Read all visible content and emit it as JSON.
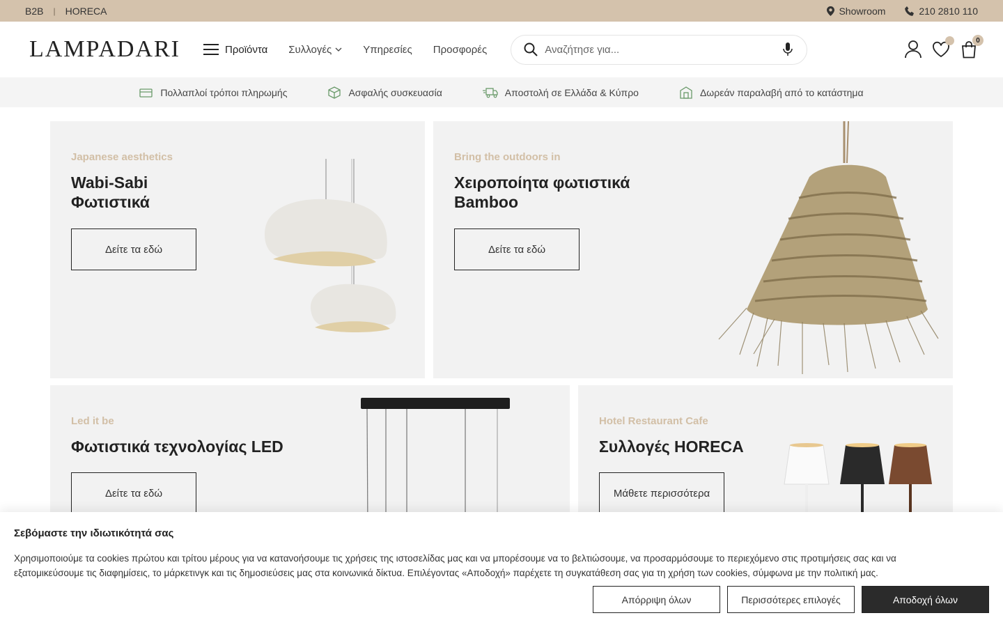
{
  "topbar": {
    "links": [
      "B2B",
      "HORECA"
    ],
    "separator": "|",
    "showroom": "Showroom",
    "phone": "210 2810 110"
  },
  "header": {
    "logo": "LAMPADARI",
    "menu_label": "Προϊόντα",
    "nav": [
      "Συλλογές",
      "Υπηρεσίες",
      "Προσφορές"
    ],
    "search_placeholder": "Αναζήτησε για...",
    "cart_count": "0"
  },
  "features": [
    "Πολλαπλοί τρόποι πληρωμής",
    "Ασφαλής συσκευασία",
    "Αποστολή σε Ελλάδα & Κύπρο",
    "Δωρεάν παραλαβή από το κατάστημα"
  ],
  "banners": [
    {
      "subtitle": "Japanese aesthetics",
      "title_line1": "Wabi-Sabi",
      "title_line2": "Φωτιστικά",
      "button": "Δείτε τα εδώ"
    },
    {
      "subtitle": "Bring the outdoors in",
      "title_line1": "Χειροποίητα φωτιστικά",
      "title_line2": "Bamboo",
      "button": "Δείτε τα εδώ"
    },
    {
      "subtitle": "Led it be",
      "title_line1": "Φωτιστικά τεχνολογίας LED",
      "button": "Δείτε τα εδώ"
    },
    {
      "subtitle": "Hotel Restaurant Cafe",
      "title_line1": "Συλλογές HORECA",
      "button": "Μάθετε περισσότερα"
    }
  ],
  "cookie": {
    "title": "Σεβόμαστε την ιδιωτικότητά σας",
    "text": "Χρησιμοποιούμε τα cookies πρώτου και τρίτου μέρους για να κατανοήσουμε τις χρήσεις της ιστοσελίδας μας και να μπορέσουμε να το βελτιώσουμε, να προσαρμόσουμε το περιεχόμενο στις προτιμήσεις σας και να εξατομικεύσουμε τις διαφημίσεις, το μάρκετινγκ και τις δημοσιεύσεις μας στα κοινωνικά δίκτυα. Επιλέγοντας «Αποδοχή» παρέχετε τη συγκατάθεση σας για τη χρήση των cookies, σύμφωνα με την πολιτική μας.",
    "reject": "Απόρριψη όλων",
    "more": "Περισσότερες επιλογές",
    "accept": "Αποδοχή όλων"
  },
  "colors": {
    "topbar": "#d4c2ac",
    "accent": "#d2bfa6",
    "dark": "#2b2b2b",
    "banner_bg": "#f2f2f2"
  }
}
